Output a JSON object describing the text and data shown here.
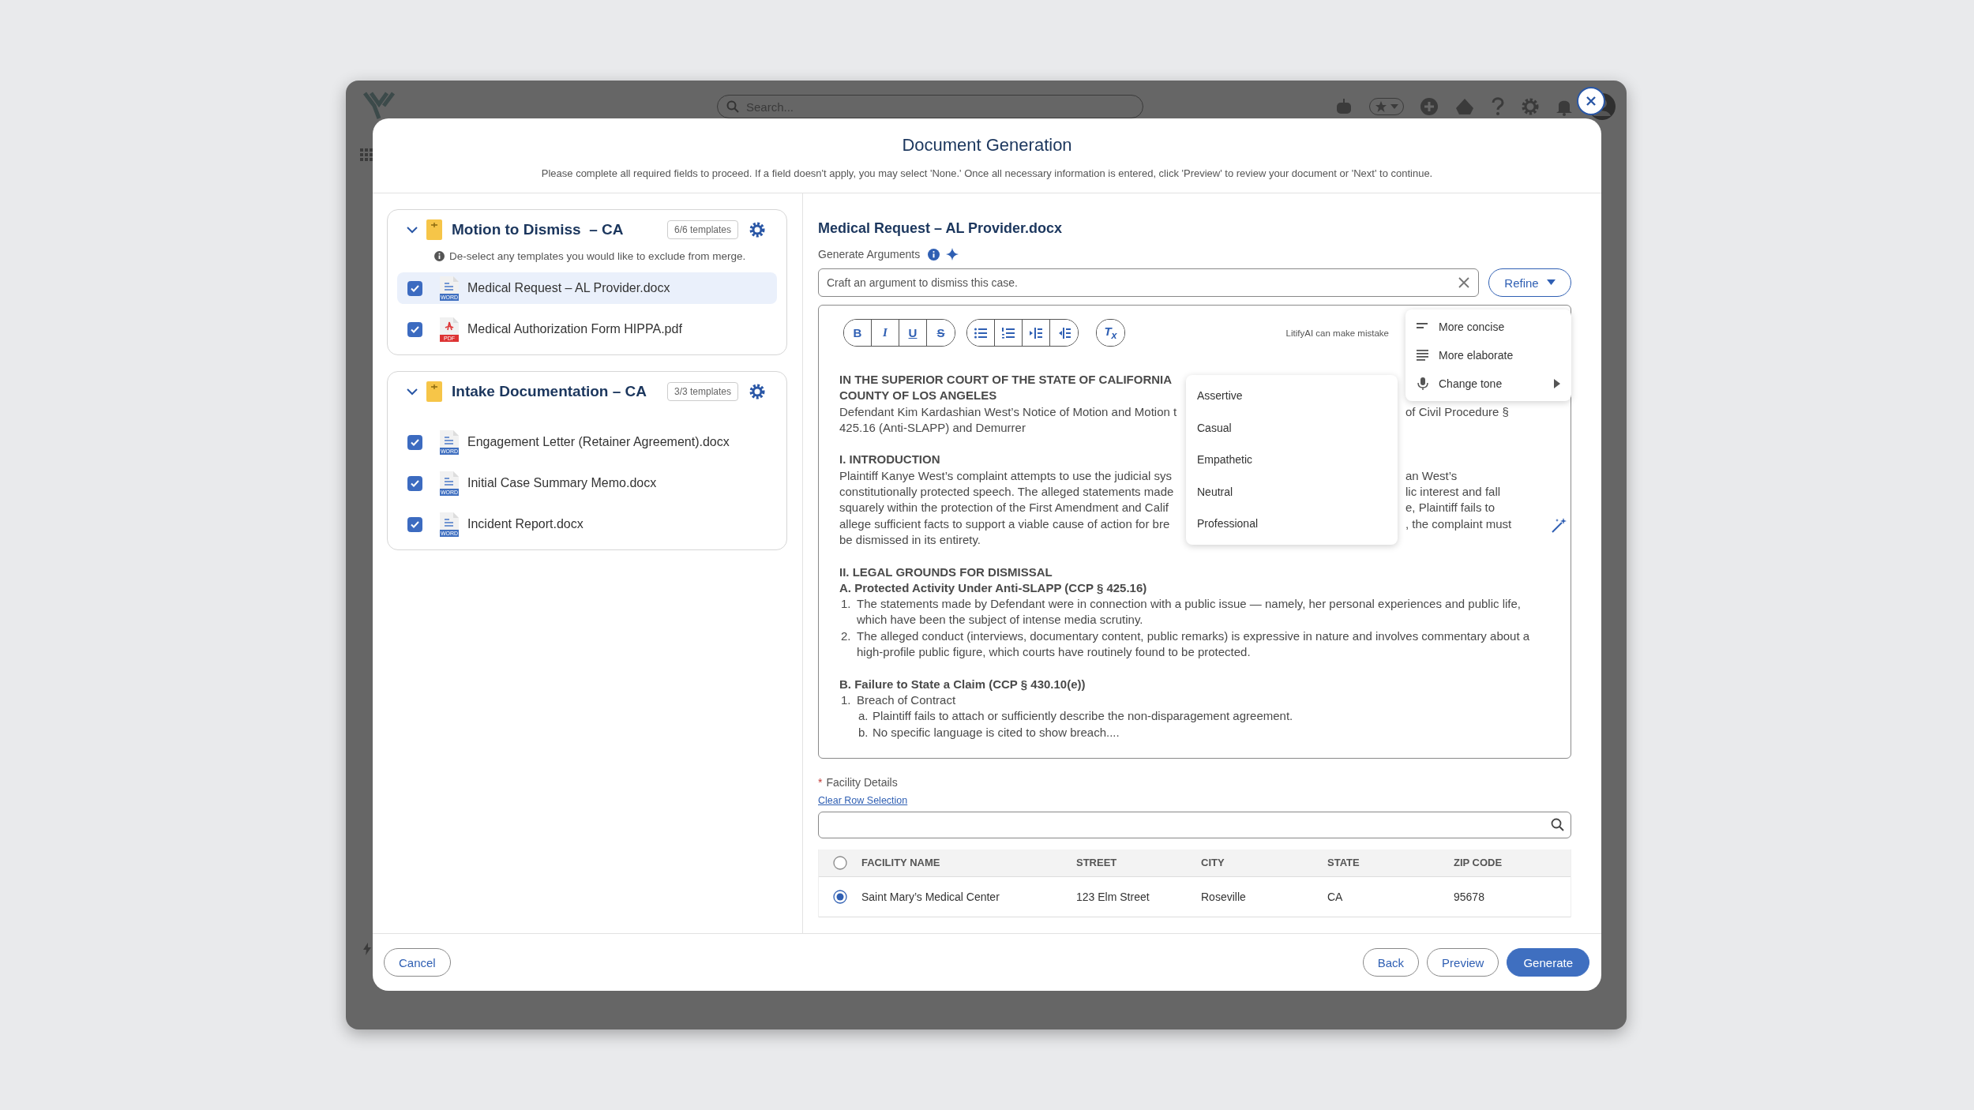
{
  "app": {
    "search_placeholder": "Search..."
  },
  "modal": {
    "title": "Document Generation",
    "instructions": "Please complete all required fields to proceed. If a field doesn't apply, you may select 'None.' Once all necessary information is entered, click 'Preview' to review your document or 'Next' to continue."
  },
  "groups": [
    {
      "title": "Motion to Dismiss  – CA",
      "count": "6/6 templates",
      "expanded": true,
      "note": "De-select any templates you would like to exclude from merge.",
      "templates": [
        {
          "name": "Medical Request – AL Provider.docx",
          "kind": "word",
          "badge": "WORD",
          "checked": true,
          "selected": true
        },
        {
          "name": "Medical Authorization Form HIPPA.pdf",
          "kind": "pdf",
          "badge": "PDF",
          "checked": true,
          "selected": false
        }
      ]
    },
    {
      "title": "Intake Documentation – CA",
      "count": "3/3 templates",
      "expanded": true,
      "templates": [
        {
          "name": "Engagement Letter (Retainer Agreement).docx",
          "kind": "word",
          "badge": "WORD",
          "checked": true,
          "selected": false
        },
        {
          "name": "Initial Case Summary Memo.docx",
          "kind": "word",
          "badge": "WORD",
          "checked": true,
          "selected": false
        },
        {
          "name": "Incident Report.docx",
          "kind": "word",
          "badge": "WORD",
          "checked": true,
          "selected": false
        }
      ]
    }
  ],
  "editor": {
    "title": "Medical Request – AL Provider.docx",
    "label": "Generate Arguments",
    "prompt": {
      "placeholder": "Craft an argument to dismiss this case."
    },
    "refine_label": "Refine",
    "toolbar": [
      [
        {
          "kind": "bold",
          "glyph": "B"
        },
        {
          "kind": "italic",
          "glyph": "I"
        },
        {
          "kind": "underline",
          "glyph": "U"
        },
        {
          "kind": "strikethrough",
          "glyph": "S"
        }
      ],
      [
        {
          "kind": "bullet-list"
        },
        {
          "kind": "numbered-list"
        },
        {
          "kind": "indent"
        },
        {
          "kind": "outdent"
        }
      ],
      [
        {
          "kind": "clear-format",
          "glyph": "T$_{x}$"
        }
      ]
    ],
    "disclaimer": "LitifyAI can make mistake",
    "sections": [
      [
        {
          "kind": "heading",
          "text": "IN THE SUPERIOR COURT OF THE STATE OF CALIFORNIA"
        },
        {
          "kind": "heading",
          "text": "COUNTY OF LOS ANGELES"
        },
        {
          "kind": "text",
          "text": "Defendant Kim Kardashian West’s Notice of Motion and Motion t",
          "text_right": "of Civil Procedure §"
        },
        {
          "kind": "text",
          "text": "425.16 (Anti-SLAPP) and Demurrer"
        }
      ],
      [
        {
          "kind": "heading",
          "text": "I. INTRODUCTION"
        },
        {
          "kind": "text",
          "text": "Plaintiff Kanye West’s complaint attempts to use the judicial sys",
          "text_right": "an West’s"
        },
        {
          "kind": "text",
          "text": "constitutionally protected speech. The alleged statements made",
          "text_right": "lic interest and fall"
        },
        {
          "kind": "text",
          "text": "squarely within the protection of the First Amendment and Calif",
          "text_right": "e, Plaintiff fails to"
        },
        {
          "kind": "text",
          "text": "allege sufficient facts to support a viable cause of action for bre",
          "text_right": ", the complaint must"
        },
        {
          "kind": "text",
          "text": "be dismissed in its entirety."
        }
      ],
      [
        {
          "kind": "heading",
          "text": "II. LEGAL GROUNDS FOR DISMISSAL"
        },
        {
          "kind": "heading",
          "text": "A. Protected Activity Under Anti-SLAPP (CCP § 425.16)"
        },
        {
          "kind": "item",
          "marker": "1.",
          "text": "The statements made by Defendant were in connection with a public issue — namely, her personal experiences and public life, which have been the subject of intense media scrutiny."
        },
        {
          "kind": "item",
          "marker": "2.",
          "text": "The alleged conduct (interviews, documentary content, public remarks) is expressive in nature and involves commentary about a high-profile public figure, which courts have routinely found to be protected."
        }
      ],
      [
        {
          "kind": "heading",
          "text": "B. Failure to State a Claim (CCP § 430.10(e))"
        },
        {
          "kind": "item",
          "marker": "1.",
          "text": "Breach of Contract"
        },
        {
          "kind": "subitem",
          "marker": "a.",
          "text": "Plaintiff fails to attach or sufficiently describe the non-disparagement agreement."
        },
        {
          "kind": "subitem",
          "marker": "b.",
          "text": "No specific language is cited to show breach...."
        }
      ]
    ],
    "refine_menu": {
      "open": true,
      "items": [
        {
          "label": "More concise"
        },
        {
          "label": "More elaborate"
        },
        {
          "label": "Change tone",
          "expanded": true,
          "options": [
            "Assertive",
            "Casual",
            "Empathetic",
            "Neutral",
            "Professional"
          ]
        }
      ]
    }
  },
  "facility": {
    "label": "Facility Details",
    "required_mark": "*",
    "clear_link": "Clear Row Selection",
    "all_selected": false,
    "columns": [
      "FACILITY NAME",
      "STREET",
      "CITY",
      "STATE",
      "ZIP CODE"
    ],
    "rows": [
      {
        "selected": true,
        "cells": [
          "Saint Mary’s Medical Center",
          "123 Elm Street",
          "Roseville",
          "CA",
          "95678"
        ]
      }
    ]
  },
  "footer": {
    "cancel": "Cancel",
    "buttons": [
      {
        "label": "Back",
        "primary": false
      },
      {
        "label": "Preview",
        "primary": false
      },
      {
        "label": "Generate",
        "primary": true
      }
    ]
  }
}
